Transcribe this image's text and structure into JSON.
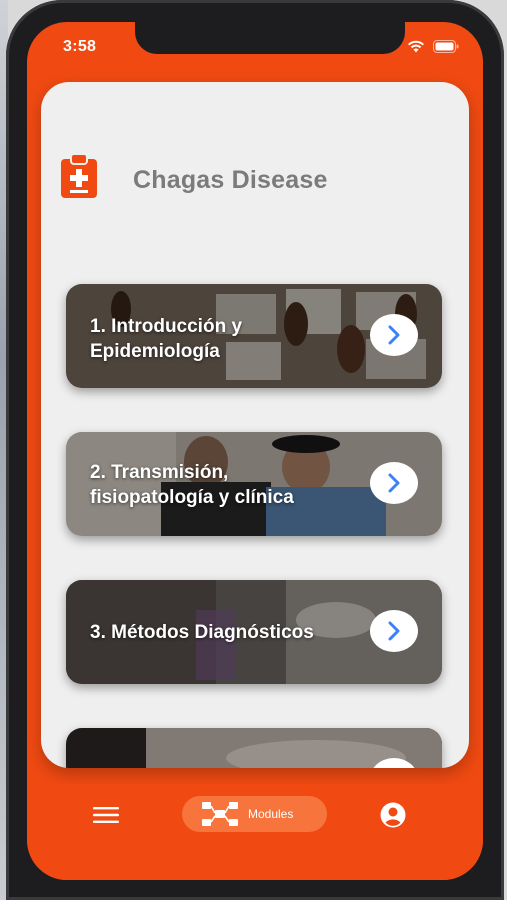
{
  "status_bar": {
    "time": "3:58",
    "wifi_icon": "wifi-icon",
    "battery_icon": "battery-icon"
  },
  "header": {
    "title": "Chagas Disease",
    "icon": "clipboard-medical-icon"
  },
  "modules": [
    {
      "label_line1": "1. Introducción y",
      "label_line2": "Epidemiología",
      "arrow_icon": "chevron-right-icon"
    },
    {
      "label_line1": "2. Transmisión,",
      "label_line2": "fisiopatología y clínica",
      "arrow_icon": "chevron-right-icon"
    },
    {
      "label_line1": "3. Métodos Diagnósticos",
      "label_line2": "",
      "arrow_icon": "chevron-right-icon"
    },
    {
      "label_line1": "",
      "label_line2": "",
      "arrow_icon": "chevron-right-icon"
    }
  ],
  "bottom_nav": {
    "menu_icon": "hamburger-menu-icon",
    "active_tab_label": "Modules",
    "active_tab_icon": "modules-network-icon",
    "account_icon": "account-circle-icon"
  },
  "colors": {
    "accent": "#f04a12",
    "card_bg": "#efefef",
    "pill": "#f7743c",
    "arrow": "#3b82f6"
  }
}
